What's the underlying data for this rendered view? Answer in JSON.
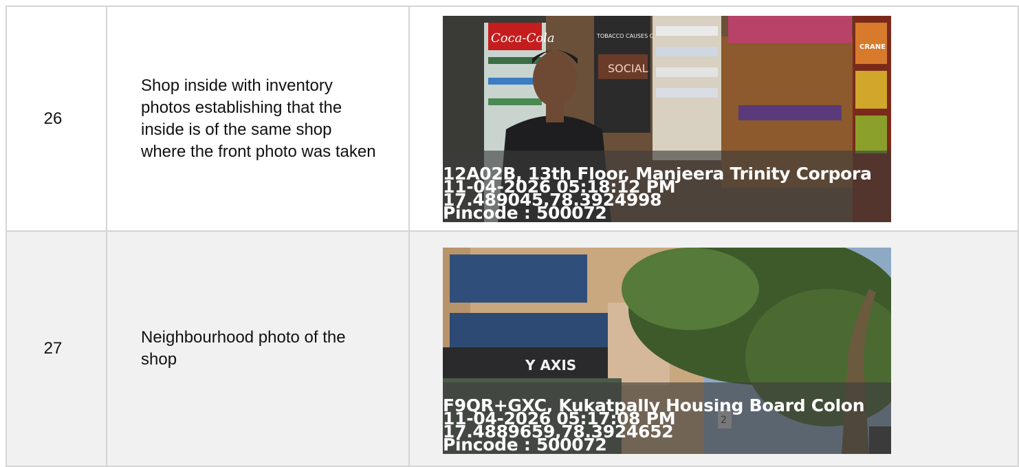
{
  "rows": [
    {
      "number": "26",
      "description": "Shop inside with inventory photos establishing that the inside is of the same shop where the front photo was taken",
      "photo": {
        "address": "12A02B, 13th Floor, Manjeera Trinity Corpora",
        "datetime": "11-04-2026 05:18:12 PM",
        "coords": "17.489045,78.3924998",
        "pincode": "Pincode : 500072",
        "signage": [
          "Coca-Cola",
          "TOBACCO CAUSES CANCER",
          "SOCIAL",
          "CRANE"
        ]
      }
    },
    {
      "number": "27",
      "description": "Neighbourhood photo of the shop",
      "photo": {
        "address": "F9QR+GXC, Kukatpally Housing Board Colon",
        "datetime": "11-04-2026 05:17:08 PM",
        "coords": "17.4889659,78.3924652",
        "pincode": "Pincode : 500072",
        "signage": [
          "Y AXIS",
          "2"
        ]
      }
    }
  ]
}
